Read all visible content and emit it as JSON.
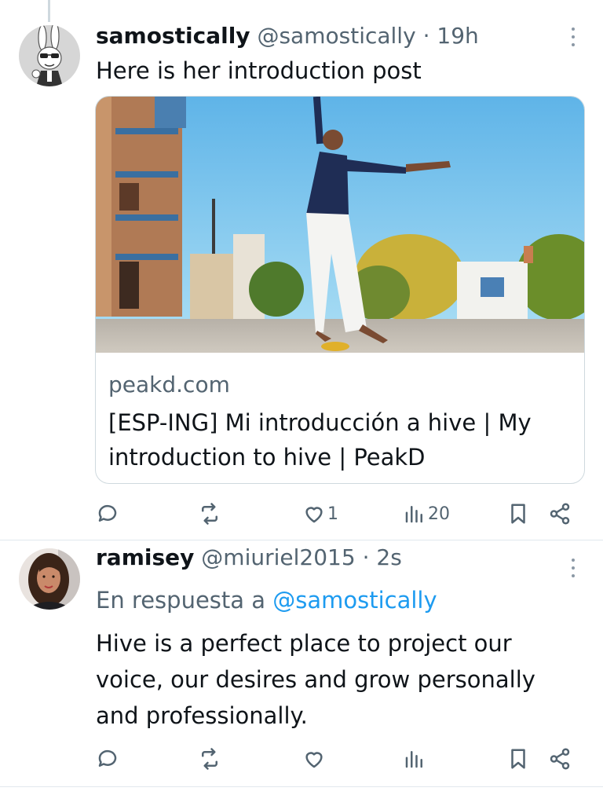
{
  "tweets": [
    {
      "name": "samostically",
      "handle": "@samostically",
      "separator": "·",
      "time": "19h",
      "text": "Here is her introduction post",
      "card": {
        "domain": "peakd.com",
        "title": "[ESP-ING] Mi introducción a hive | My introduction to hive | PeakD"
      },
      "actions": {
        "replies": "",
        "retweets": "",
        "likes": "1",
        "views": "20"
      }
    },
    {
      "name": "ramisey",
      "handle": "@miuriel2015",
      "separator": "·",
      "time": "2s",
      "reply_prefix": "En respuesta a",
      "reply_mention": "@samostically",
      "text": "Hive is a perfect place to project our voice, our desires and grow personally and professionally.",
      "actions": {
        "replies": "",
        "retweets": "",
        "likes": "",
        "views": ""
      }
    }
  ],
  "colors": {
    "text": "#0f1419",
    "secondary": "#536471",
    "accent": "#1d9bf0",
    "border": "#cfd9de"
  }
}
